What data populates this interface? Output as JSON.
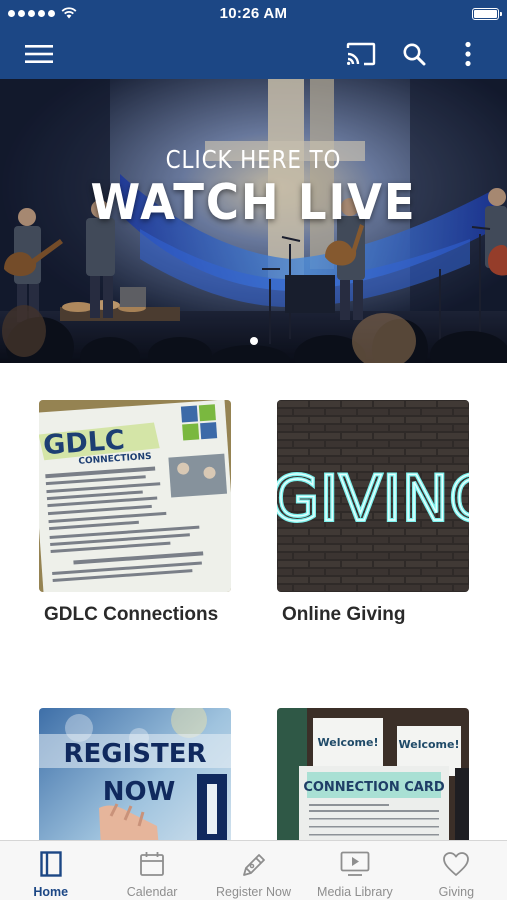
{
  "status_bar": {
    "time": "10:26 AM"
  },
  "app_bar": {
    "icons": [
      "menu-icon",
      "cast-icon",
      "search-icon",
      "more-vertical-icon"
    ]
  },
  "hero": {
    "line1": "CLICK HERE TO",
    "line2": "WATCH LIVE"
  },
  "tiles": [
    {
      "label": "GDLC Connections"
    },
    {
      "label": "Online Giving"
    },
    {
      "label": ""
    },
    {
      "label": ""
    }
  ],
  "tile_art": {
    "flyer_title": "GDLC",
    "flyer_subtitle": "CONNECTIONS",
    "neon": "GIVING",
    "register_1": "REGISTER",
    "register_2": "NOW",
    "card_sign_1": "Welcome!",
    "card_sign_2": "Welcome!",
    "card_title": "CONNECTION CARD"
  },
  "tab_bar": {
    "items": [
      {
        "label": "Home",
        "icon": "home-book-icon",
        "active": true
      },
      {
        "label": "Calendar",
        "icon": "calendar-icon",
        "active": false
      },
      {
        "label": "Register Now",
        "icon": "pen-icon",
        "active": false
      },
      {
        "label": "Media Library",
        "icon": "play-screen-icon",
        "active": false
      },
      {
        "label": "Giving",
        "icon": "heart-icon",
        "active": false
      }
    ]
  },
  "colors": {
    "brand": "#1c4785",
    "active_tab": "#1c4785",
    "inactive_tab": "#8e8e8e"
  }
}
